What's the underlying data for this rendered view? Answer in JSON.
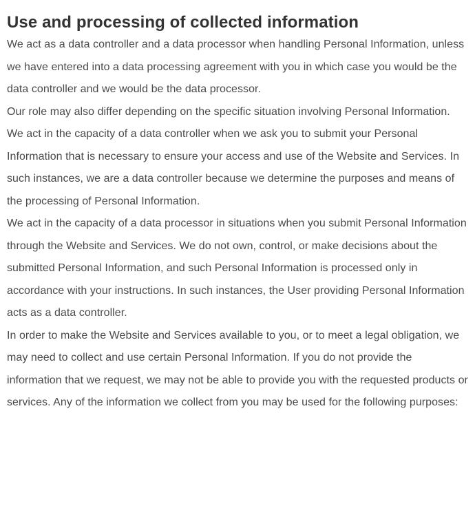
{
  "section": {
    "title": "Use and processing of collected information",
    "paragraphs": [
      "We act as a data controller and a data processor when handling Personal Information, unless we have entered into a data processing agreement with you in which case you would be the data controller and we would be the data processor.",
      "Our role may also differ depending on the specific situation involving Personal Information. We act in the capacity of a data controller when we ask you to submit your Personal Information that is necessary to ensure your access and use of the Website and Services. In such instances, we are a data controller because we determine the purposes and means of the processing of Personal Information.",
      "We act in the capacity of a data processor in situations when you submit Personal Information through the Website and Services. We do not own, control, or make decisions about the submitted Personal Information, and such Personal Information is processed only in accordance with your instructions. In such instances, the User providing Personal Information acts as a data controller.",
      "In order to make the Website and Services available to you, or to meet a legal obligation, we may need to collect and use certain Personal Information. If you do not provide the information that we request, we may not be able to provide you with the requested products or services. Any of the information we collect from you may be used for the following purposes:"
    ]
  }
}
